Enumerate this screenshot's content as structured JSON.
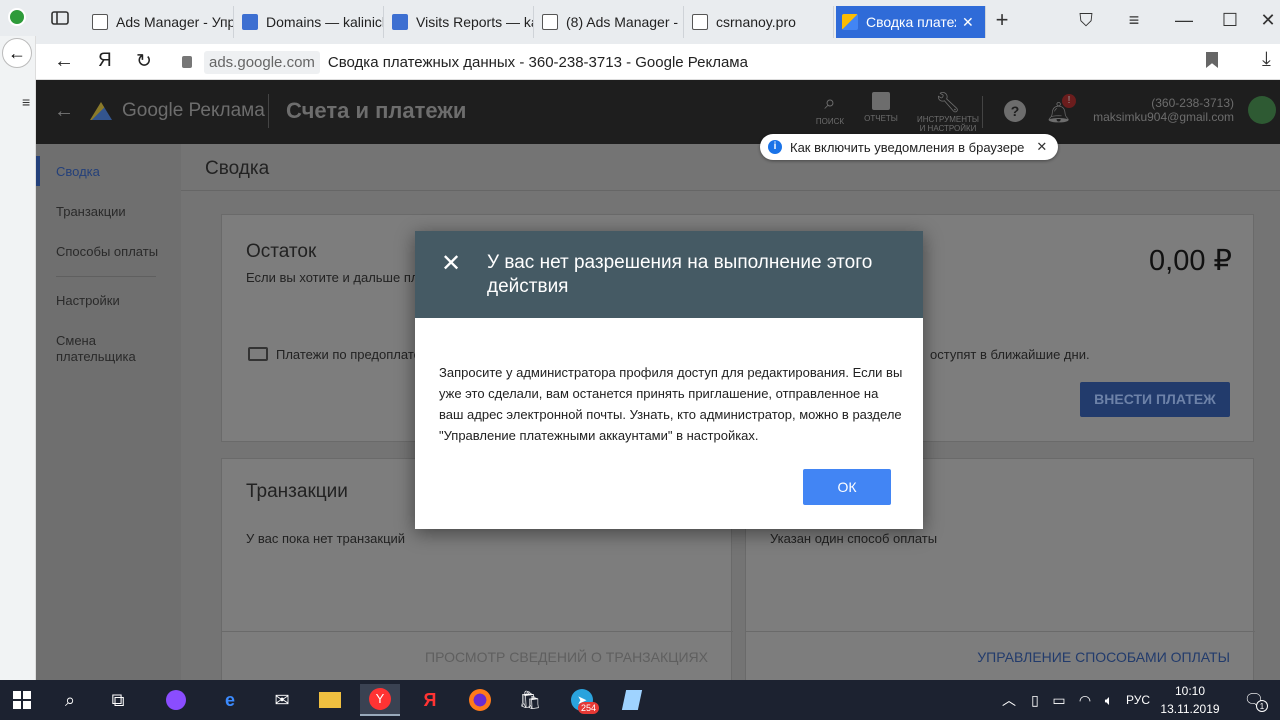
{
  "browser": {
    "tabs": [
      {
        "label": "Ads Manager - Упр",
        "active": false
      },
      {
        "label": "Domains — kalinich",
        "active": false
      },
      {
        "label": "Visits Reports — ka",
        "active": false
      },
      {
        "label": "(8) Ads Manager -",
        "active": false
      },
      {
        "label": "csrnanoy.pro",
        "active": false
      },
      {
        "label": "Сводка платеж",
        "active": true
      }
    ],
    "address_domain": "ads.google.com",
    "address_title": "Сводка платежных данных - 360-238-3713 - Google Реклама"
  },
  "header": {
    "brand": "Google Реклама",
    "section_title": "Счета и платежи",
    "icons": [
      {
        "name": "search-icon",
        "label": "ПОИСК"
      },
      {
        "name": "reports-icon",
        "label": "ОТЧЕТЫ"
      },
      {
        "name": "tools-icon",
        "label": "ИНСТРУМЕНТЫ И НАСТРОЙКИ"
      }
    ],
    "notification_badge": "!",
    "account_id": "(360-238-3713)",
    "account_email": "maksimku904@gmail.com"
  },
  "notification_chip": {
    "text": "Как включить уведомления в браузере"
  },
  "sidenav": {
    "items": [
      {
        "label": "Сводка",
        "active": true
      },
      {
        "label": "Транзакции",
        "active": false
      },
      {
        "label": "Способы оплаты",
        "active": false
      },
      {
        "label": "Настройки",
        "active": false
      },
      {
        "label": "Смена плательщика",
        "active": false
      }
    ]
  },
  "main": {
    "page_title": "Сводка",
    "balance": {
      "title": "Остаток",
      "description": "Если вы хотите и дальше пл",
      "amount": "0,00 ₽",
      "payment_method_text": "Платежи по предоплате",
      "arrive_text": "оступят в ближайшие дни.",
      "pay_button": "ВНЕСТИ ПЛАТЕЖ"
    },
    "transactions": {
      "title": "Транзакции",
      "empty_text": "У вас пока нет транзакций",
      "link": "ПРОСМОТР СВЕДЕНИЙ О ТРАНЗАКЦИЯХ"
    },
    "payment_methods": {
      "text": "Указан один способ оплаты",
      "link": "УПРАВЛЕНИЕ СПОСОБАМИ ОПЛАТЫ"
    }
  },
  "dialog": {
    "title": "У вас нет разрешения на выполнение этого действия",
    "body": "Запросите у администратора профиля доступ для редактирования. Если вы уже это сделали, вам останется принять приглашение, отправленное на ваш адрес электронной почты. Узнать, кто администратор, можно в разделе \"Управление платежными аккаунтами\" в настройках.",
    "ok_button": "ОК"
  },
  "taskbar": {
    "language": "РУС",
    "time": "10:10",
    "date": "13.11.2019",
    "telegram_badge": "254",
    "notification_count": "1"
  },
  "colors": {
    "dialog_header": "#455a64",
    "primary_button": "#4285f4",
    "active_tab": "#2f6bd8"
  }
}
